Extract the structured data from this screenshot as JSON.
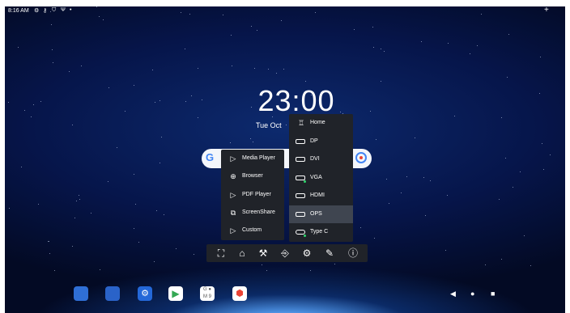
{
  "status_bar": {
    "time": "8:16 AM",
    "icons": [
      "gear-icon",
      "key-icon",
      "shield-icon",
      "usb-icon",
      "dot-icon"
    ],
    "right_icon": "add-icon"
  },
  "clock": {
    "time": "23:00",
    "date": "Tue Oct"
  },
  "search": {
    "logo": "G",
    "lens_icon": "lens-icon"
  },
  "app_menu": [
    {
      "label": "Media Player",
      "icon": "play-icon"
    },
    {
      "label": "Browser",
      "icon": "globe-icon"
    },
    {
      "label": "PDF Player",
      "icon": "play-icon"
    },
    {
      "label": "ScreenShare",
      "icon": "screenshare-icon"
    },
    {
      "label": "Custom",
      "icon": "play-icon"
    }
  ],
  "source_menu": [
    {
      "label": "Home",
      "icon": "home-source-icon",
      "signal": false,
      "selected": false
    },
    {
      "label": "DP",
      "icon": "dp-port-icon",
      "signal": false,
      "selected": false
    },
    {
      "label": "DVI",
      "icon": "dvi-port-icon",
      "signal": false,
      "selected": false
    },
    {
      "label": "VGA",
      "icon": "vga-port-icon",
      "signal": true,
      "selected": false
    },
    {
      "label": "HDMI",
      "icon": "hdmi-port-icon",
      "signal": false,
      "selected": false
    },
    {
      "label": "OPS",
      "icon": "ops-port-icon",
      "signal": false,
      "selected": true
    },
    {
      "label": "Type C",
      "icon": "usbc-port-icon",
      "signal": true,
      "selected": false
    }
  ],
  "toolbar": [
    "fullscreen-icon",
    "home-icon",
    "tools-icon",
    "input-source-icon",
    "settings-icon",
    "pen-icon",
    "info-icon"
  ],
  "dock": {
    "apps": [
      {
        "icon": "board-app-icon",
        "color": "#2f6fd6"
      },
      {
        "icon": "files-app-icon",
        "color": "#2a63c9"
      },
      {
        "icon": "settings-app-icon",
        "color": "#2468d8"
      },
      {
        "icon": "play-store-icon",
        "color": "#ffffff"
      },
      {
        "icon": "google-apps-icon",
        "color": "#ffffff"
      },
      {
        "icon": "maps-app-icon",
        "color": "#ffffff"
      }
    ],
    "nav": [
      "back-icon",
      "home-dot-icon",
      "recents-icon"
    ]
  },
  "colors": {
    "panel": "#202329",
    "selected_row": "#3f4550",
    "signal": "#2fd46b"
  }
}
